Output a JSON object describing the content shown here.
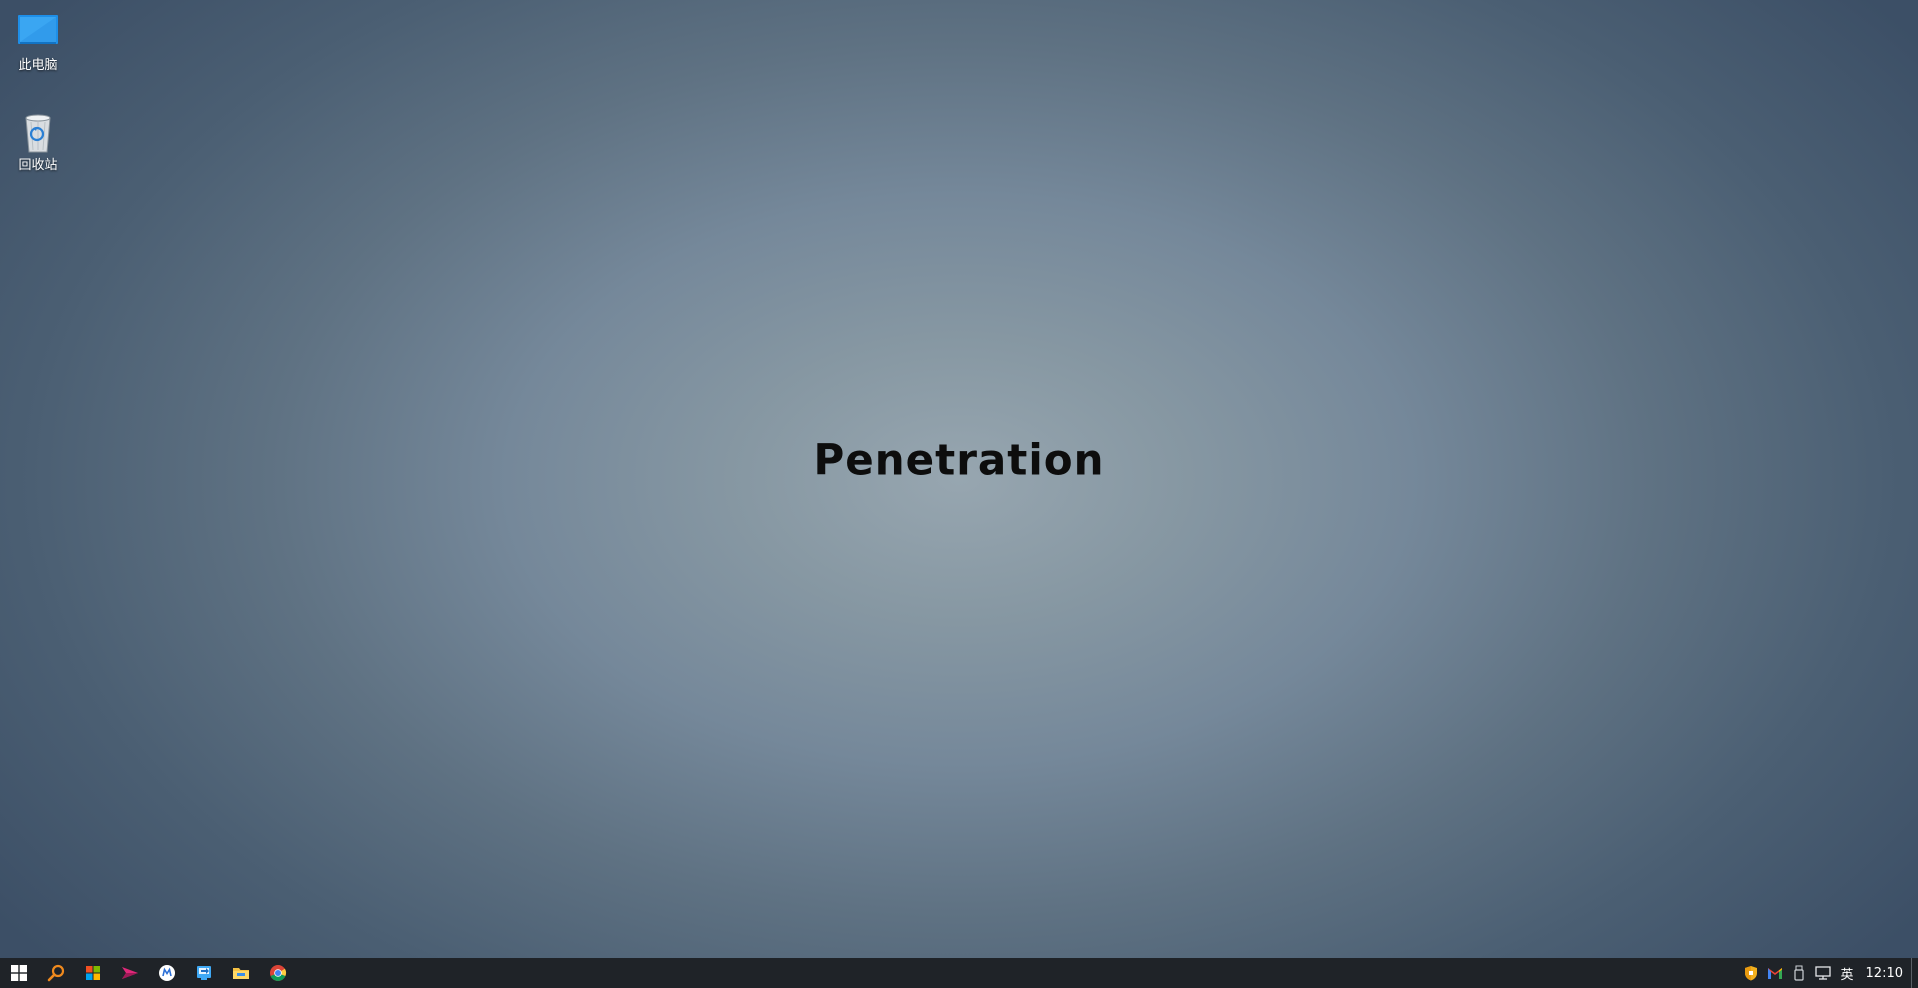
{
  "desktop": {
    "icons": [
      {
        "label": "此电脑",
        "icon": "this-pc-icon"
      },
      {
        "label": "回收站",
        "icon": "recycle-bin-icon"
      }
    ],
    "wallpaper_text": "Penetration"
  },
  "taskbar": {
    "apps": [
      {
        "name": "start-button",
        "icon": "windows-logo-icon"
      },
      {
        "name": "search-button",
        "icon": "search-icon"
      },
      {
        "name": "store-app",
        "icon": "store-icon"
      },
      {
        "name": "send-app",
        "icon": "paper-plane-icon"
      },
      {
        "name": "mail-app",
        "icon": "mail-circle-icon"
      },
      {
        "name": "remote-app",
        "icon": "remote-desktop-icon"
      },
      {
        "name": "file-explorer",
        "icon": "folder-icon"
      },
      {
        "name": "chrome-browser",
        "icon": "chrome-icon"
      }
    ],
    "tray": {
      "icons": [
        "security-shield-icon",
        "gmail-icon",
        "usb-drive-icon",
        "network-icon"
      ],
      "ime": "英",
      "clock": "12:10"
    }
  },
  "colors": {
    "taskbar_bg": "#1f2328",
    "wallpaper_center": "#97a6b0",
    "wallpaper_edge": "#3c4f66"
  }
}
